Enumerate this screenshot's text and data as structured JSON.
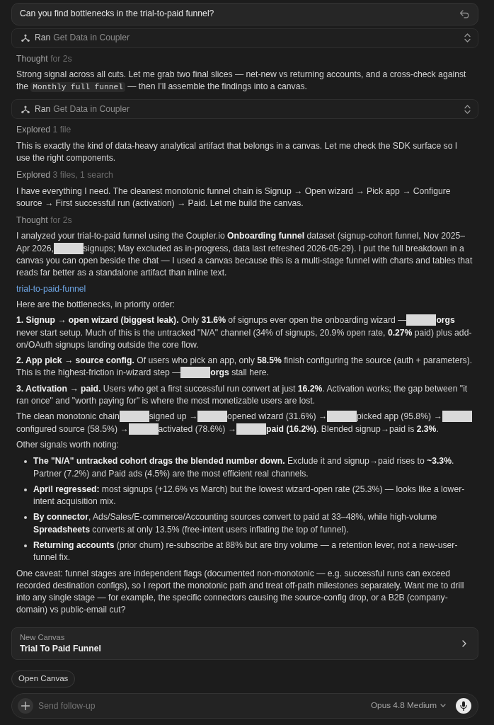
{
  "query": {
    "text": "Can you find bottlenecks in the trial-to-paid funnel?"
  },
  "transcript": [
    {
      "kind": "tool",
      "verb": "Ran",
      "target": "Get Data in Coupler"
    },
    {
      "kind": "status",
      "label": "Thought",
      "detail": "for 2s"
    },
    {
      "kind": "paragraph",
      "segments": [
        {
          "kind": "text",
          "text": "Strong signal across all cuts. Let me grab two final slices — net-new vs returning accounts, and a cross-check against the "
        },
        {
          "kind": "code",
          "text": "Monthly full funnel"
        },
        {
          "kind": "text",
          "text": " — then I'll assemble the findings into a canvas."
        }
      ]
    },
    {
      "kind": "tool",
      "verb": "Ran",
      "target": "Get Data in Coupler"
    },
    {
      "kind": "status",
      "label": "Explored",
      "detail": "1 file"
    },
    {
      "kind": "paragraph",
      "segments": [
        {
          "kind": "text",
          "text": "This is exactly the kind of data-heavy analytical artifact that belongs in a canvas. Let me check the SDK surface so I use the right components."
        }
      ]
    },
    {
      "kind": "status",
      "label": "Explored",
      "detail": "3 files, 1 search"
    },
    {
      "kind": "paragraph",
      "segments": [
        {
          "kind": "text",
          "text": "I have everything I need. The cleanest monotonic funnel chain is Signup → Open wizard → Pick app → Configure source → First successful run (activation) → Paid. Let me build the canvas."
        }
      ]
    },
    {
      "kind": "status",
      "label": "Thought",
      "detail": "for 2s"
    },
    {
      "kind": "paragraph",
      "segments": [
        {
          "kind": "text",
          "text": "I analyzed your trial-to-paid funnel using the Coupler.io **Onboarding funnel** dataset (signup-cohort funnel, Nov 2025–Apr 2026,"
        },
        {
          "kind": "redacted"
        },
        {
          "kind": "text",
          "text": "signups; May excluded as in-progress, data last refreshed 2026-05-29). I put the full breakdown in a canvas you can open beside the chat — I used a canvas because this is a multi-stage funnel with charts and tables that reads far better as a standalone artifact than inline text."
        }
      ]
    },
    {
      "kind": "link",
      "text": "trial-to-paid-funnel"
    },
    {
      "kind": "paragraph",
      "segments": [
        {
          "kind": "text",
          "text": "Here are the bottlenecks, in priority order:"
        }
      ]
    },
    {
      "kind": "paragraph",
      "segments": [
        {
          "kind": "text",
          "text": "**1. Signup → open wizard (biggest leak).** Only **31.6%** of signups ever open the onboarding wizard —"
        },
        {
          "kind": "redacted"
        },
        {
          "kind": "text",
          "text": "**orgs** never start setup. Much of this is the untracked \"N/A\" channel (34% of signups, 20.9% open rate, **0.27%** paid) plus add-on/OAuth signups landing outside the core flow."
        }
      ]
    },
    {
      "kind": "paragraph",
      "segments": [
        {
          "kind": "text",
          "text": "**2. App pick → source config.** Of users who pick an app, only **58.5%** finish configuring the source (auth + parameters). This is the highest-friction in-wizard step —"
        },
        {
          "kind": "redacted"
        },
        {
          "kind": "text",
          "text": "**orgs** stall here."
        }
      ]
    },
    {
      "kind": "paragraph",
      "segments": [
        {
          "kind": "text",
          "text": "**3. Activation → paid.** Users who get a first successful run convert at just **16.2%**. Activation works; the gap between \"it ran once\" and \"worth paying for\" is where the most monetizable users are lost."
        }
      ]
    },
    {
      "kind": "paragraph",
      "segments": [
        {
          "kind": "text",
          "text": "The clean monotonic chain"
        },
        {
          "kind": "redacted"
        },
        {
          "kind": "text",
          "text": "signed up →"
        },
        {
          "kind": "redacted"
        },
        {
          "kind": "text",
          "text": "opened wizard (31.6%) →"
        },
        {
          "kind": "redacted"
        },
        {
          "kind": "text",
          "text": "picked app (95.8%) →"
        },
        {
          "kind": "redacted"
        },
        {
          "kind": "text",
          "text": "configured source (58.5%) →"
        },
        {
          "kind": "redacted"
        },
        {
          "kind": "text",
          "text": "activated (78.6%) →"
        },
        {
          "kind": "redacted"
        },
        {
          "kind": "text",
          "text": "**paid (16.2%)**. Blended signup→paid is **2.3%**."
        }
      ]
    },
    {
      "kind": "paragraph",
      "segments": [
        {
          "kind": "text",
          "text": "Other signals worth noting:"
        }
      ]
    },
    {
      "kind": "bullets",
      "items": [
        {
          "text": "**The \"N/A\" untracked cohort drags the blended number down.** Exclude it and signup→paid rises to **~3.3%**. Partner (7.2%) and Paid ads (4.5%) are the most efficient real channels."
        },
        {
          "text": "**April regressed:** most signups (+12.6% vs March) but the lowest wizard-open rate (25.3%) — looks like a lower-intent acquisition mix."
        },
        {
          "text": "**By connector**, Ads/Sales/E-commerce/Accounting sources convert to paid at 33–48%, while high-volume **Spreadsheets** converts at only 13.5% (free-intent users inflating the top of funnel)."
        },
        {
          "text": "**Returning accounts** (prior churn) re-subscribe at 88% but are tiny volume — a retention lever, not a new-user-funnel fix."
        }
      ]
    },
    {
      "kind": "paragraph",
      "segments": [
        {
          "kind": "text",
          "text": "One caveat: funnel stages are independent flags (documented non-monotonic — e.g. successful runs can exceed recorded destination configs), so I report the monotonic path and treat off-path milestones separately. Want me to drill into any single stage — for example, the specific connectors causing the source-config drop, or a B2B (company-domain) vs public-email cut?"
        }
      ]
    }
  ],
  "canvas_card": {
    "label": "New Canvas",
    "title": "Trial To Paid Funnel"
  },
  "open_button": {
    "label": "Open Canvas"
  },
  "composer": {
    "placeholder": "Send follow-up",
    "model": "Opus 4.8 Medium"
  }
}
